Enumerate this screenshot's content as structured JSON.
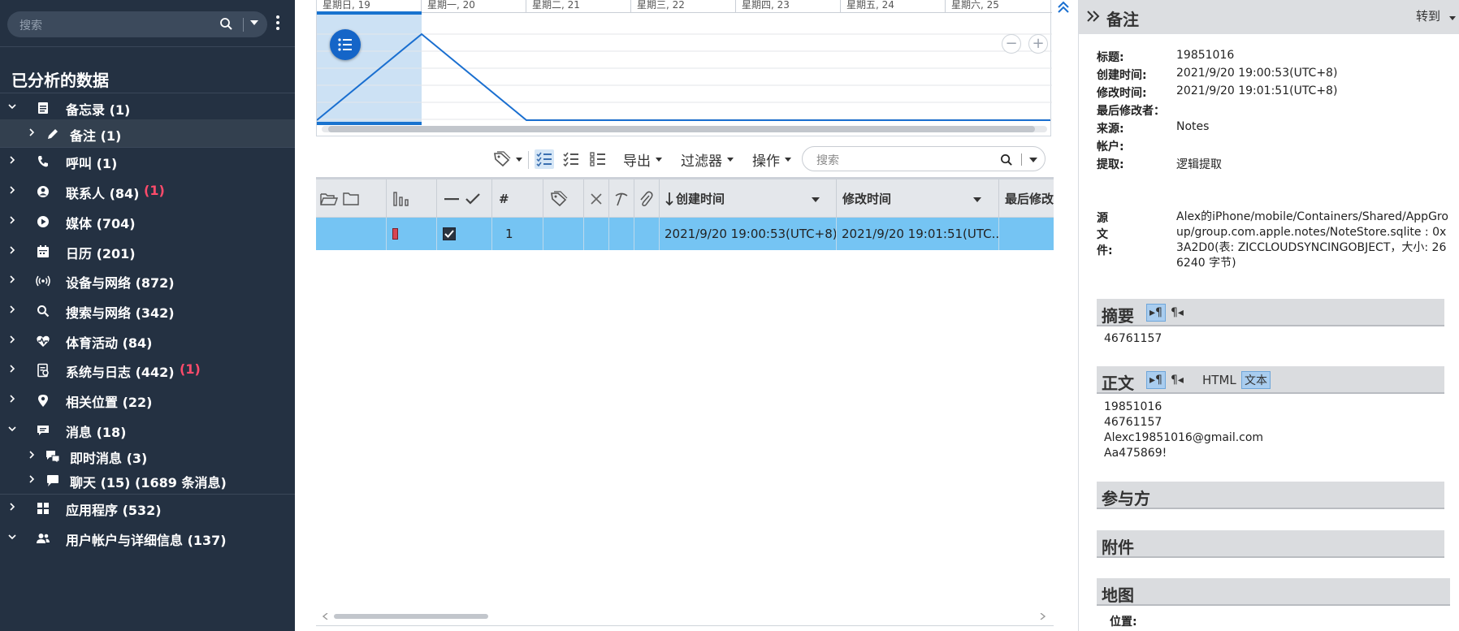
{
  "colors": {
    "sidebar_bg": "#243142",
    "selection_row": "#75c4f3",
    "accent": "#1565c8",
    "badge": "#ff4b6b"
  },
  "sidebar": {
    "search_placeholder": "搜索",
    "title": "已分析的数据",
    "items": [
      {
        "label": "备忘录 (1)",
        "badge": "",
        "icon": "notebook-icon",
        "expanded": true
      },
      {
        "label": "备注 (1)",
        "badge": "",
        "icon": "pencil-icon",
        "child": true,
        "selected": true
      },
      {
        "label": "呼叫 (1)",
        "badge": "",
        "icon": "phone-icon"
      },
      {
        "label": "联系人 (84)",
        "badge": "(1)",
        "icon": "contact-icon"
      },
      {
        "label": "媒体 (704)",
        "badge": "",
        "icon": "play-icon"
      },
      {
        "label": "日历 (201)",
        "badge": "",
        "icon": "calendar-icon"
      },
      {
        "label": "设备与网络 (872)",
        "badge": "",
        "icon": "antenna-icon"
      },
      {
        "label": "搜索与网络 (342)",
        "badge": "",
        "icon": "search-icon"
      },
      {
        "label": "体育活动 (84)",
        "badge": "",
        "icon": "heart-pulse-icon"
      },
      {
        "label": "系统与日志 (442)",
        "badge": "(1)",
        "icon": "log-icon"
      },
      {
        "label": "相关位置 (22)",
        "badge": "",
        "icon": "location-pin-icon"
      },
      {
        "label": "消息 (18)",
        "badge": "",
        "icon": "message-icon",
        "expanded": true
      },
      {
        "label": "即时消息 (3)",
        "badge": "",
        "icon": "instant-message-icon",
        "child": true
      },
      {
        "label": "聊天 (15)  (1689 条消息)",
        "badge": "",
        "icon": "chat-icon",
        "child": true
      },
      {
        "label": "应用程序 (532)",
        "badge": "",
        "icon": "apps-grid-icon"
      },
      {
        "label": "用户帐户与详细信息 (137)",
        "badge": "",
        "icon": "users-icon",
        "expanded": true
      }
    ]
  },
  "timeline": {
    "days": [
      "星期日, 19",
      "星期一, 20",
      "星期二, 21",
      "星期三, 22",
      "星期四, 23",
      "星期五, 24",
      "星期六, 25"
    ],
    "counts": [
      0,
      1,
      0,
      0,
      0,
      0,
      0,
      0
    ]
  },
  "toolbar": {
    "export_label": "导出",
    "filter_label": "过滤器",
    "actions_label": "操作",
    "search_placeholder": "搜索"
  },
  "grid": {
    "columns": {
      "number": "#",
      "created": "创建时间",
      "modified": "修改时间",
      "last_modified_by": "最后修改"
    },
    "rows": [
      {
        "index": "1",
        "checked": true,
        "created": "2021/9/20 19:00:53(UTC+8)",
        "modified": "2021/9/20 19:01:51(UTC..."
      }
    ]
  },
  "detail": {
    "title": "备注",
    "goto_label": "转到",
    "fields": [
      {
        "key": "标题:",
        "value": "19851016"
      },
      {
        "key": "创建时间:",
        "value": "2021/9/20 19:00:53(UTC+8)"
      },
      {
        "key": "修改时间:",
        "value": "2021/9/20 19:01:51(UTC+8)"
      },
      {
        "key": "最后修改者：",
        "value": ""
      },
      {
        "key": "来源:",
        "value": "Notes"
      },
      {
        "key": "帐户:",
        "value": ""
      },
      {
        "key": "提取:",
        "value": "逻辑提取"
      }
    ],
    "source_file_key": "源文件:",
    "source_file_value": "Alex的iPhone/mobile/Containers/Shared/AppGroup/group.com.apple.notes/NoteStore.sqlite : 0x3A2D0(表: ZICCLOUDSYNCINGOBJECT，大小: 266240 字节)",
    "summary_title": "摘要",
    "summary_text": "46761157",
    "body_title": "正文",
    "body_html_label": "HTML",
    "body_text_label": "文本",
    "body_text": "19851016\n46761157\nAlexc19851016@gmail.com\nAa475869!",
    "participants_title": "参与方",
    "attachments_title": "附件",
    "map_title": "地图",
    "location_label": "位置:"
  }
}
